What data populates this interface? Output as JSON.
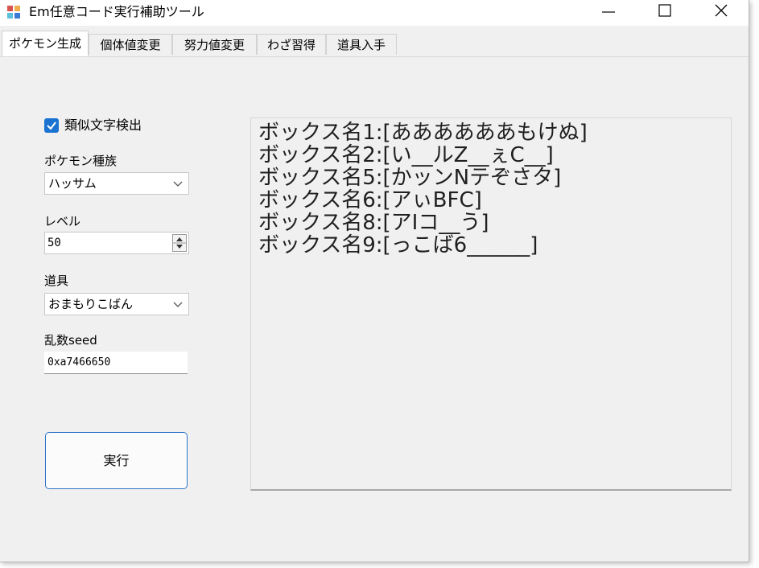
{
  "window": {
    "title": "Em任意コード実行補助ツール",
    "buttons": [
      "minimize",
      "maximize",
      "close"
    ]
  },
  "tabs": [
    {
      "label": "ポケモン生成",
      "active": true
    },
    {
      "label": "個体値変更",
      "active": false
    },
    {
      "label": "努力値変更",
      "active": false
    },
    {
      "label": "わざ習得",
      "active": false
    },
    {
      "label": "道具入手",
      "active": false
    }
  ],
  "form": {
    "similar_char_check": {
      "label": "類似文字検出",
      "checked": true
    },
    "species": {
      "label": "ポケモン種族",
      "value": "ハッサム"
    },
    "level": {
      "label": "レベル",
      "value": "50"
    },
    "item": {
      "label": "道具",
      "value": "おまもりこばん"
    },
    "seed": {
      "label": "乱数seed",
      "value": "0xa7466650"
    },
    "run_label": "実行"
  },
  "output_lines": [
    "ボックス名1:[ああああああもけぬ]",
    "ボックス名2:[い__ルZ__ぇC__]",
    "ボックス名5:[かッンNテぞさタ]",
    "ボックス名6:[アぃBFC]",
    "ボックス名8:[アIコ__う]",
    "ボックス名9:[っこば6______]"
  ],
  "colors": {
    "window_bg": "#f0f0f0",
    "checkbox": "#1a73d0",
    "button_border": "#2b73c8"
  }
}
